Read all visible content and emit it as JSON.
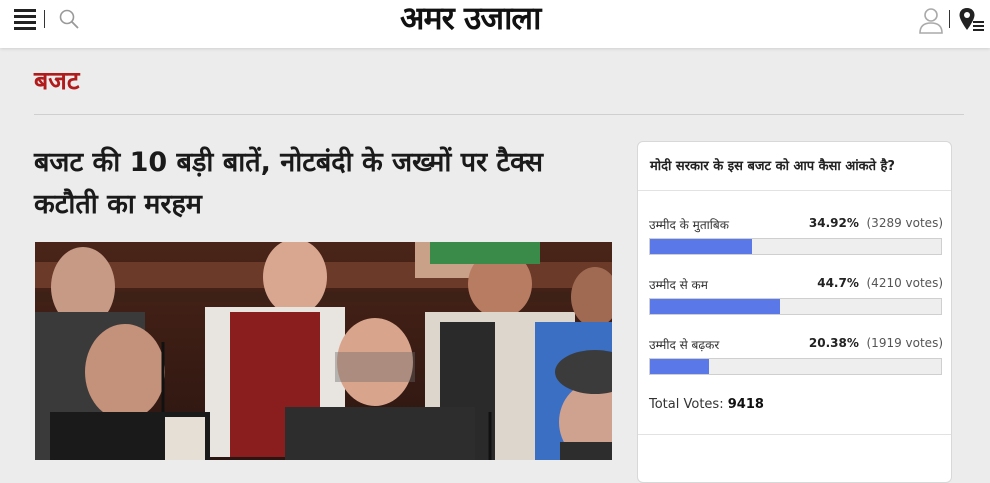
{
  "header": {
    "logo": "अमर उजाला",
    "icons": [
      "hamburger-menu-icon",
      "search-icon",
      "user-icon",
      "location-menu-icon"
    ]
  },
  "section": {
    "title": "बजट"
  },
  "article": {
    "headline": "बजट की 10 बड़ी बातें, नोटबंदी के जख्मों पर टैक्स कटौती का मरहम"
  },
  "poll": {
    "question": "मोदी सरकार के इस बजट को आप कैसा आंकते है?",
    "options": [
      {
        "label": "उम्मीद के मुताबिक",
        "percent_text": "34.92%",
        "votes_text": "(3289 votes)",
        "fraction": 0.3492
      },
      {
        "label": "उम्मीद से कम",
        "percent_text": "44.7%",
        "votes_text": "(4210 votes)",
        "fraction": 0.447
      },
      {
        "label": "उम्मीद से बढ़कर",
        "percent_text": "20.38%",
        "votes_text": "(1919 votes)",
        "fraction": 0.2038
      }
    ],
    "total_label": "Total Votes:",
    "total_value": "9418",
    "bar_color": "#5b78e8"
  },
  "colors": {
    "section": "#b11b1b",
    "background": "#ececec"
  }
}
